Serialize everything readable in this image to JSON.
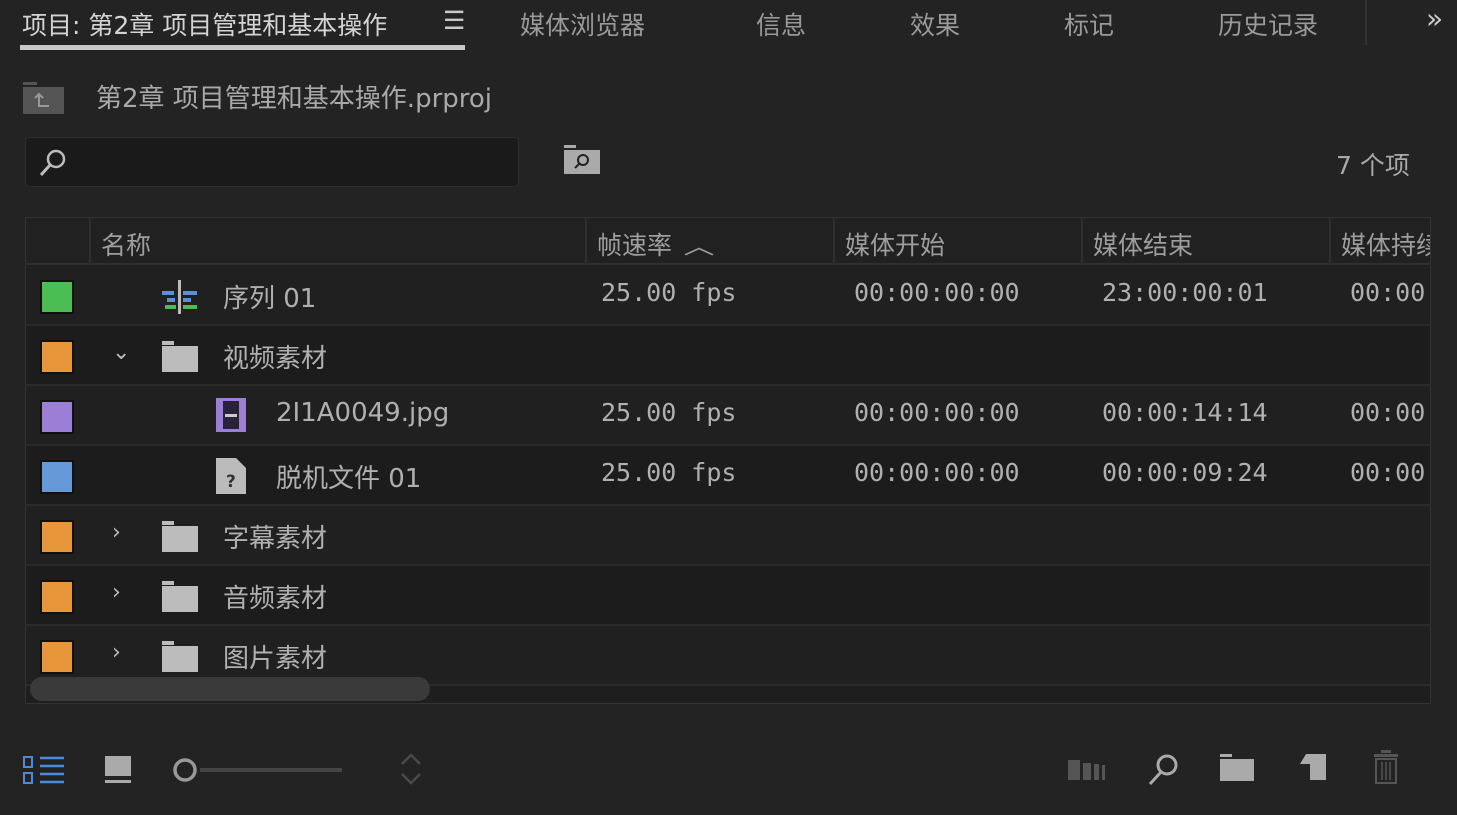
{
  "tabs": [
    {
      "label": "项目: 第2章 项目管理和基本操作"
    },
    {
      "label": "媒体浏览器"
    },
    {
      "label": "信息"
    },
    {
      "label": "效果"
    },
    {
      "label": "标记"
    },
    {
      "label": "历史记录"
    }
  ],
  "project_file": "第2章 项目管理和基本操作.prproj",
  "search": {
    "value": "",
    "placeholder": ""
  },
  "item_count": "7 个项",
  "columns": [
    "名称",
    "帧速率",
    "媒体开始",
    "媒体结束",
    "媒体持续"
  ],
  "rows": [
    {
      "name": "序列 01",
      "type": "sequence",
      "color": "#4cbd53",
      "fps": "25.00 fps",
      "start": "00:00:00:00",
      "end": "23:00:00:01",
      "dur": "00:00"
    },
    {
      "name": "视频素材",
      "type": "folder",
      "expanded": true,
      "color": "#e8963a",
      "fps": "",
      "start": "",
      "end": "",
      "dur": ""
    },
    {
      "name": "2I1A0049.jpg",
      "type": "image",
      "color": "#9b7ed6",
      "fps": "25.00 fps",
      "start": "00:00:00:00",
      "end": "00:00:14:14",
      "dur": "00:00"
    },
    {
      "name": "脱机文件 01",
      "type": "offline",
      "color": "#6699d8",
      "fps": "25.00 fps",
      "start": "00:00:00:00",
      "end": "00:00:09:24",
      "dur": "00:00"
    },
    {
      "name": "字幕素材",
      "type": "folder",
      "expanded": false,
      "color": "#e8963a",
      "fps": "",
      "start": "",
      "end": "",
      "dur": ""
    },
    {
      "name": "音频素材",
      "type": "folder",
      "expanded": false,
      "color": "#e8963a",
      "fps": "",
      "start": "",
      "end": "",
      "dur": ""
    },
    {
      "name": "图片素材",
      "type": "folder",
      "expanded": false,
      "color": "#e8963a",
      "fps": "",
      "start": "",
      "end": "",
      "dur": ""
    }
  ],
  "zoom_slider": 0,
  "accent": "#4a8be0"
}
